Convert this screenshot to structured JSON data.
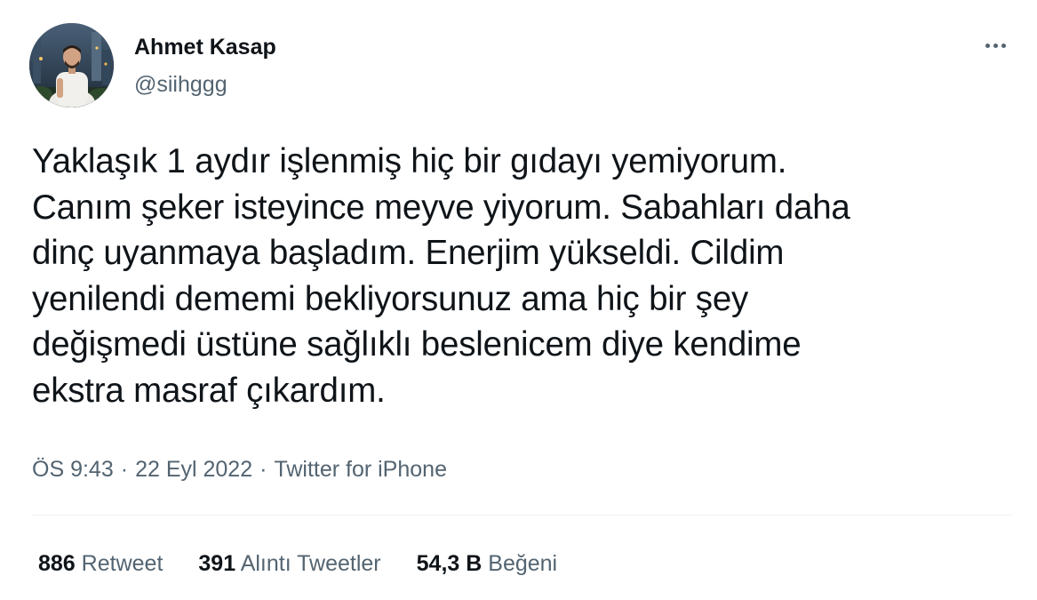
{
  "author": {
    "name": "Ahmet Kasap",
    "handle": "@siihggg"
  },
  "more_icon": "more-horizontal-icon",
  "tweet": {
    "text": "Yaklaşık 1 aydır işlenmiş hiç bir gıdayı yemiyorum.\nCanım şeker isteyince meyve yiyorum. Sabahları daha\ndinç uyanmaya başladım. Enerjim yükseldi. Cildim\nyenilendi dememi bekliyorsunuz ama hiç bir şey\ndeğişmedi üstüne sağlıklı beslenicem diye kendime\nekstra masraf çıkardım.",
    "time": "ÖS 9:43",
    "date": "22 Eyl 2022",
    "separator": "·",
    "source": "Twitter for iPhone"
  },
  "stats": {
    "retweets": {
      "count": "886",
      "label": "Retweet"
    },
    "quotes": {
      "count": "391",
      "label": "Alıntı Tweetler"
    },
    "likes": {
      "count": "54,3 B",
      "label": "Beğeni"
    }
  },
  "colors": {
    "primary_text": "#0f1419",
    "secondary_text": "#536471",
    "divider": "#eff3f4",
    "background": "#ffffff"
  }
}
